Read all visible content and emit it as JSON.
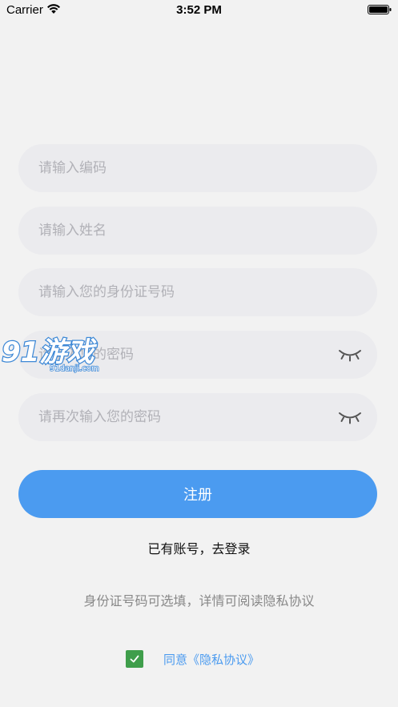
{
  "status_bar": {
    "carrier": "Carrier",
    "time": "3:52 PM"
  },
  "form": {
    "code_placeholder": "请输入编码",
    "name_placeholder": "请输入姓名",
    "id_placeholder": "请输入您的身份证号码",
    "password_placeholder": "请输入您的密码",
    "confirm_placeholder": "请再次输入您的密码"
  },
  "actions": {
    "register_label": "注册",
    "login_link": "已有账号，去登录"
  },
  "hint": "身份证号码可选填，详情可阅读隐私协议",
  "agreement": {
    "checked": true,
    "label": "同意《隐私协议》"
  },
  "watermark": {
    "logo_text": "91游戏",
    "site": "91danji.com"
  },
  "colors": {
    "accent": "#4b9bf0",
    "checkbox": "#3f9e4b",
    "field_bg": "#ebebee",
    "page_bg": "#f2f2f2"
  },
  "icons": {
    "password_toggle": "eye-closed-icon",
    "wifi": "wifi-icon",
    "battery": "battery-icon",
    "check": "check-icon"
  }
}
